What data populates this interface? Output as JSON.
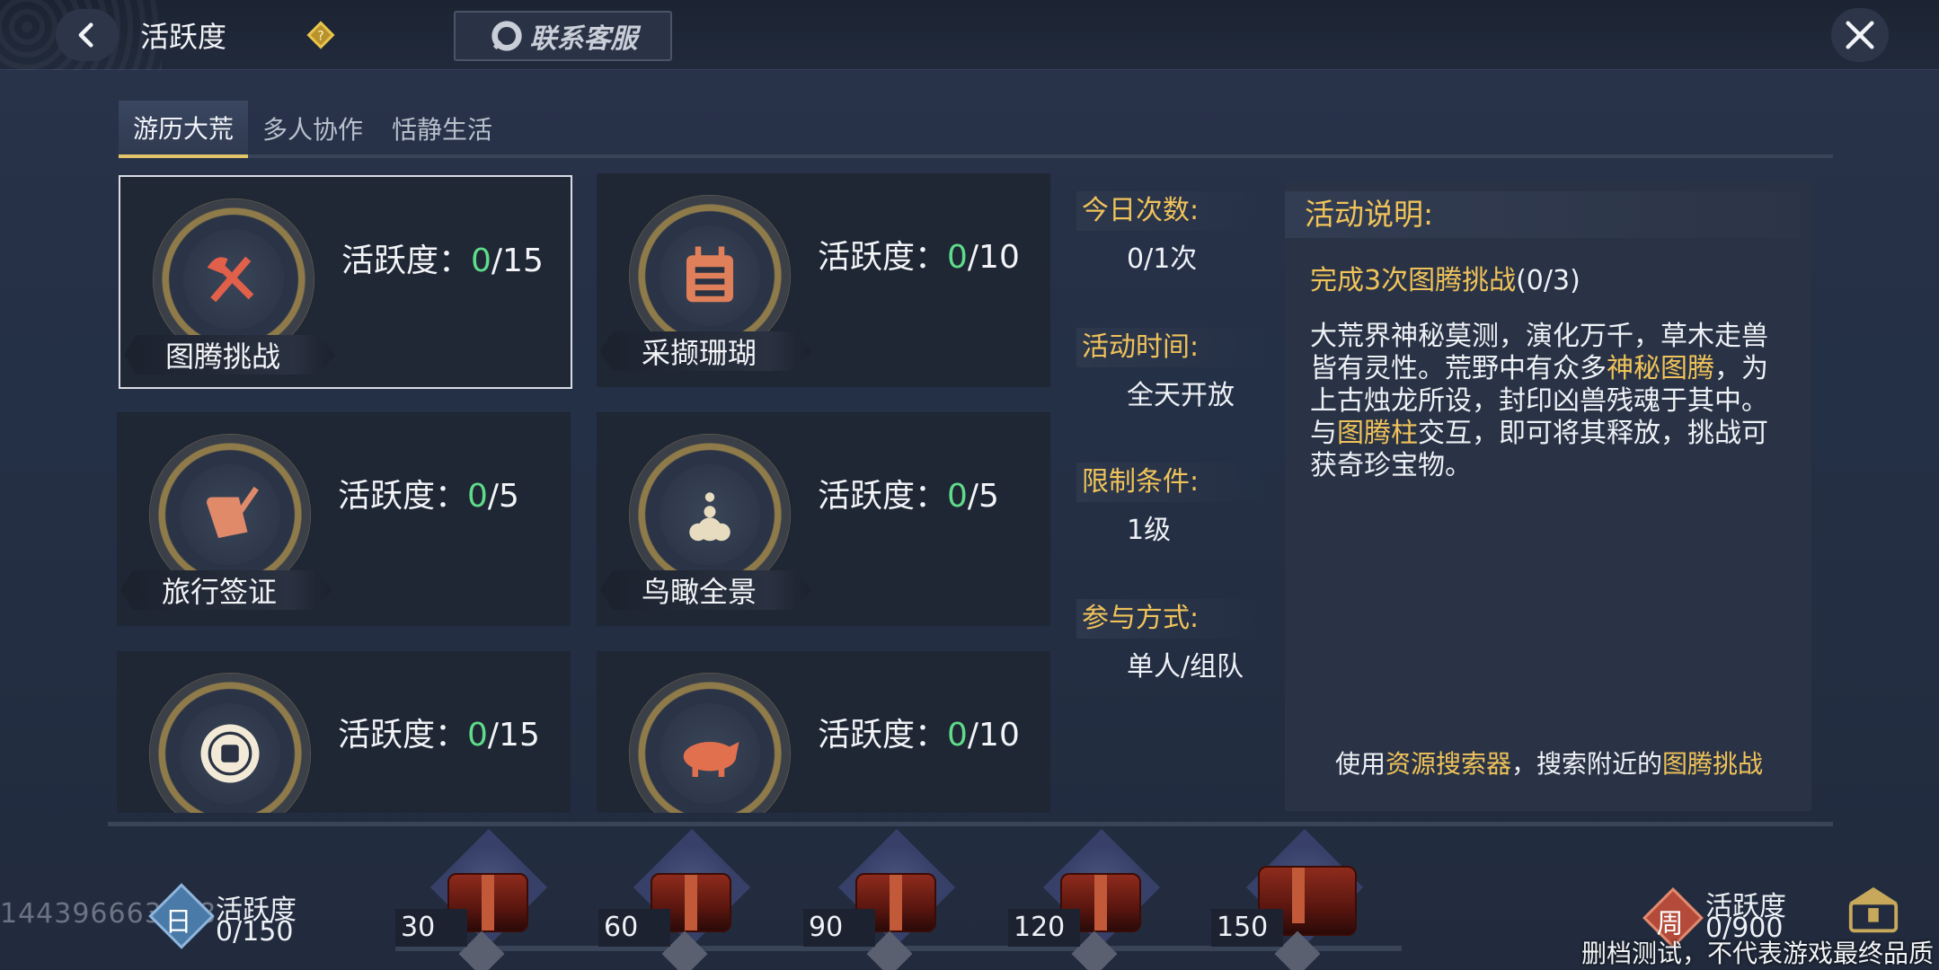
{
  "header": {
    "title": "活跃度",
    "service_label": "联系客服"
  },
  "tabs": [
    {
      "label": "游历大荒",
      "active": true
    },
    {
      "label": "多人协作",
      "active": false
    },
    {
      "label": "恬静生活",
      "active": false
    }
  ],
  "tasks": [
    {
      "name": "图腾挑战",
      "act_label": "活跃度：",
      "current": "0",
      "max": "/15",
      "icon": "axe-sword-icon"
    },
    {
      "name": "采撷珊瑚",
      "act_label": "活跃度：",
      "current": "0",
      "max": "/10",
      "icon": "calendar-icon"
    },
    {
      "name": "旅行签证",
      "act_label": "活跃度：",
      "current": "0",
      "max": "/5",
      "icon": "scroll-quill-icon"
    },
    {
      "name": "鸟瞰全景",
      "act_label": "活跃度：",
      "current": "0",
      "max": "/5",
      "icon": "stone-pile-icon"
    },
    {
      "name": "",
      "act_label": "活跃度：",
      "current": "0",
      "max": "/15",
      "icon": "coin-icon"
    },
    {
      "name": "",
      "act_label": "活跃度：",
      "current": "0",
      "max": "/10",
      "icon": "boar-icon"
    }
  ],
  "info": {
    "daily_count_label": "今日次数:",
    "daily_count": "0/1次",
    "time_label": "活动时间:",
    "time": "全天开放",
    "limit_label": "限制条件:",
    "limit": "1级",
    "mode_label": "参与方式:",
    "mode": "单人/组队"
  },
  "description": {
    "heading": "活动说明:",
    "goal": "完成3次图腾挑战",
    "goal_progress": "(0/3)",
    "p1": "大荒界神秘莫测，演化万千，草木走兽皆有灵性。荒野中有众多",
    "p1_highlight": "神秘图腾",
    "p2": "，为上古烛龙所设，封印凶兽残魂于其中。",
    "p3_a": "与",
    "p3_highlight": "图腾柱",
    "p3_b": "交互，即可将其释放，挑战可获奇珍宝物。",
    "tip_a": "使用",
    "tip_highlight1": "资源搜索器",
    "tip_b": "，搜索附近的",
    "tip_highlight2": "图腾挑战"
  },
  "rewards": {
    "daily_badge": "日",
    "daily_label": "活跃度",
    "daily_value": "0/150",
    "thresholds": [
      "30",
      "60",
      "90",
      "120",
      "150"
    ],
    "weekly_badge": "周",
    "weekly_label": "活跃度",
    "weekly_value": "0/900"
  },
  "watermark_id": "144396663018",
  "disclaimer": "删档测试，不代表游戏最终品质",
  "colors": {
    "accent_gold": "#f0c35a",
    "progress_green": "#5fdc8a",
    "background": "#242c3c"
  }
}
